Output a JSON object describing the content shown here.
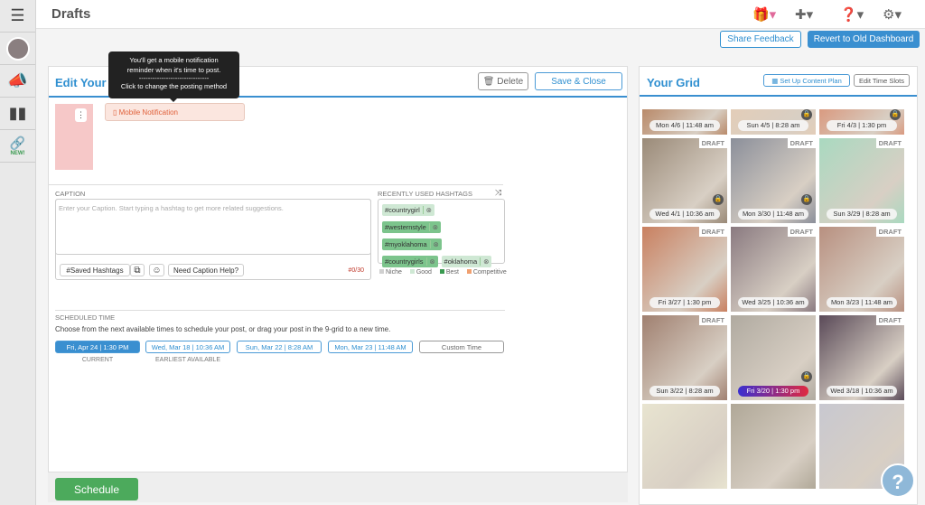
{
  "header": {
    "title": "Drafts"
  },
  "toolbar": {
    "share_feedback": "Share Feedback",
    "revert": "Revert to Old Dashboard"
  },
  "sidebar": {
    "new_badge": "NEW!"
  },
  "editor": {
    "title": "Edit Your Post",
    "delete": "Delete",
    "save_close": "Save & Close",
    "tooltip_line1": "You'll get a mobile notification",
    "tooltip_line2": "reminder when it's time to post.",
    "tooltip_sep": "-------------------------------",
    "tooltip_line3": "Click to change the posting method",
    "posting_method": "Mobile Notification",
    "caption_label": "Caption",
    "caption_placeholder": "Enter your Caption. Start typing a hashtag to get more related suggestions.",
    "saved_hashtags": "Saved Hashtags",
    "caption_help": "Need Caption Help?",
    "counter": "#0/30",
    "hashtags_label": "Recently Used Hashtags",
    "hashtags": [
      {
        "text": "#countrygirl",
        "level": "Good"
      },
      {
        "text": "#westernstyle",
        "level": "Best"
      },
      {
        "text": "#myoklahoma",
        "level": "Best"
      },
      {
        "text": "#countrygirls",
        "level": "Best"
      },
      {
        "text": "#oklahoma",
        "level": "Good"
      }
    ],
    "legend": [
      {
        "label": "Niche",
        "color": "#d0d0d0"
      },
      {
        "label": "Good",
        "color": "#cfe8d4"
      },
      {
        "label": "Best",
        "color": "#3a9a50"
      },
      {
        "label": "Competitive",
        "color": "#f0a070"
      }
    ],
    "scheduled_label": "Scheduled Time",
    "scheduled_help": "Choose from the next available times to schedule your post, or drag your post in the 9-grid to a new time.",
    "slots": [
      {
        "label": "Fri, Apr 24 | 1:30 PM",
        "sub": "Current"
      },
      {
        "label": "Wed, Mar 18 | 10:36 AM",
        "sub": "Earliest Available"
      },
      {
        "label": "Sun, Mar 22 | 8:28 AM",
        "sub": ""
      },
      {
        "label": "Mon, Mar 23 | 11:48 AM",
        "sub": ""
      },
      {
        "label": "Custom Time",
        "sub": ""
      }
    ],
    "schedule": "Schedule"
  },
  "grid": {
    "title": "Your Grid",
    "content_plan": "Set Up Content Plan",
    "time_slots": "Edit Time Slots",
    "draft": "DRAFT",
    "cells": [
      {
        "time": "Mon 4/6 | 11:48 am",
        "draft": false,
        "lock": false,
        "c": "#b98a6a"
      },
      {
        "time": "Sun 4/5 | 8:28 am",
        "draft": false,
        "lock": true,
        "c": "#e3cdb8"
      },
      {
        "time": "Fri 4/3 | 1:30 pm",
        "draft": false,
        "lock": true,
        "c": "#d99a80"
      },
      {
        "time": "Wed 4/1 | 10:36 am",
        "draft": true,
        "lock": true,
        "c": "#9a8a78"
      },
      {
        "time": "Mon 3/30 | 11:48 am",
        "draft": true,
        "lock": true,
        "c": "#8b8f9a"
      },
      {
        "time": "Sun 3/29 | 8:28 am",
        "draft": true,
        "lock": false,
        "c": "#a9d9c0"
      },
      {
        "time": "Fri 3/27 | 1:30 pm",
        "draft": true,
        "lock": false,
        "c": "#c98060"
      },
      {
        "time": "Wed 3/25 | 10:36 am",
        "draft": true,
        "lock": false,
        "c": "#8a7a80"
      },
      {
        "time": "Mon 3/23 | 11:48 am",
        "draft": true,
        "lock": false,
        "c": "#b89080"
      },
      {
        "time": "Sun 3/22 | 8:28 am",
        "draft": true,
        "lock": false,
        "c": "#a08070"
      },
      {
        "time": "Fri 3/20 | 1:30 pm",
        "draft": false,
        "lock": true,
        "c": "#b0aaa0"
      },
      {
        "time": "Wed 3/18 | 10:36 am",
        "draft": true,
        "lock": false,
        "c": "#5a4a58"
      },
      {
        "time": "",
        "draft": false,
        "lock": false,
        "c": "#e8e4d0"
      },
      {
        "time": "",
        "draft": false,
        "lock": false,
        "c": "#b0a898"
      },
      {
        "time": "",
        "draft": false,
        "lock": false,
        "c": "#c8c8d0"
      }
    ]
  },
  "help": "?"
}
